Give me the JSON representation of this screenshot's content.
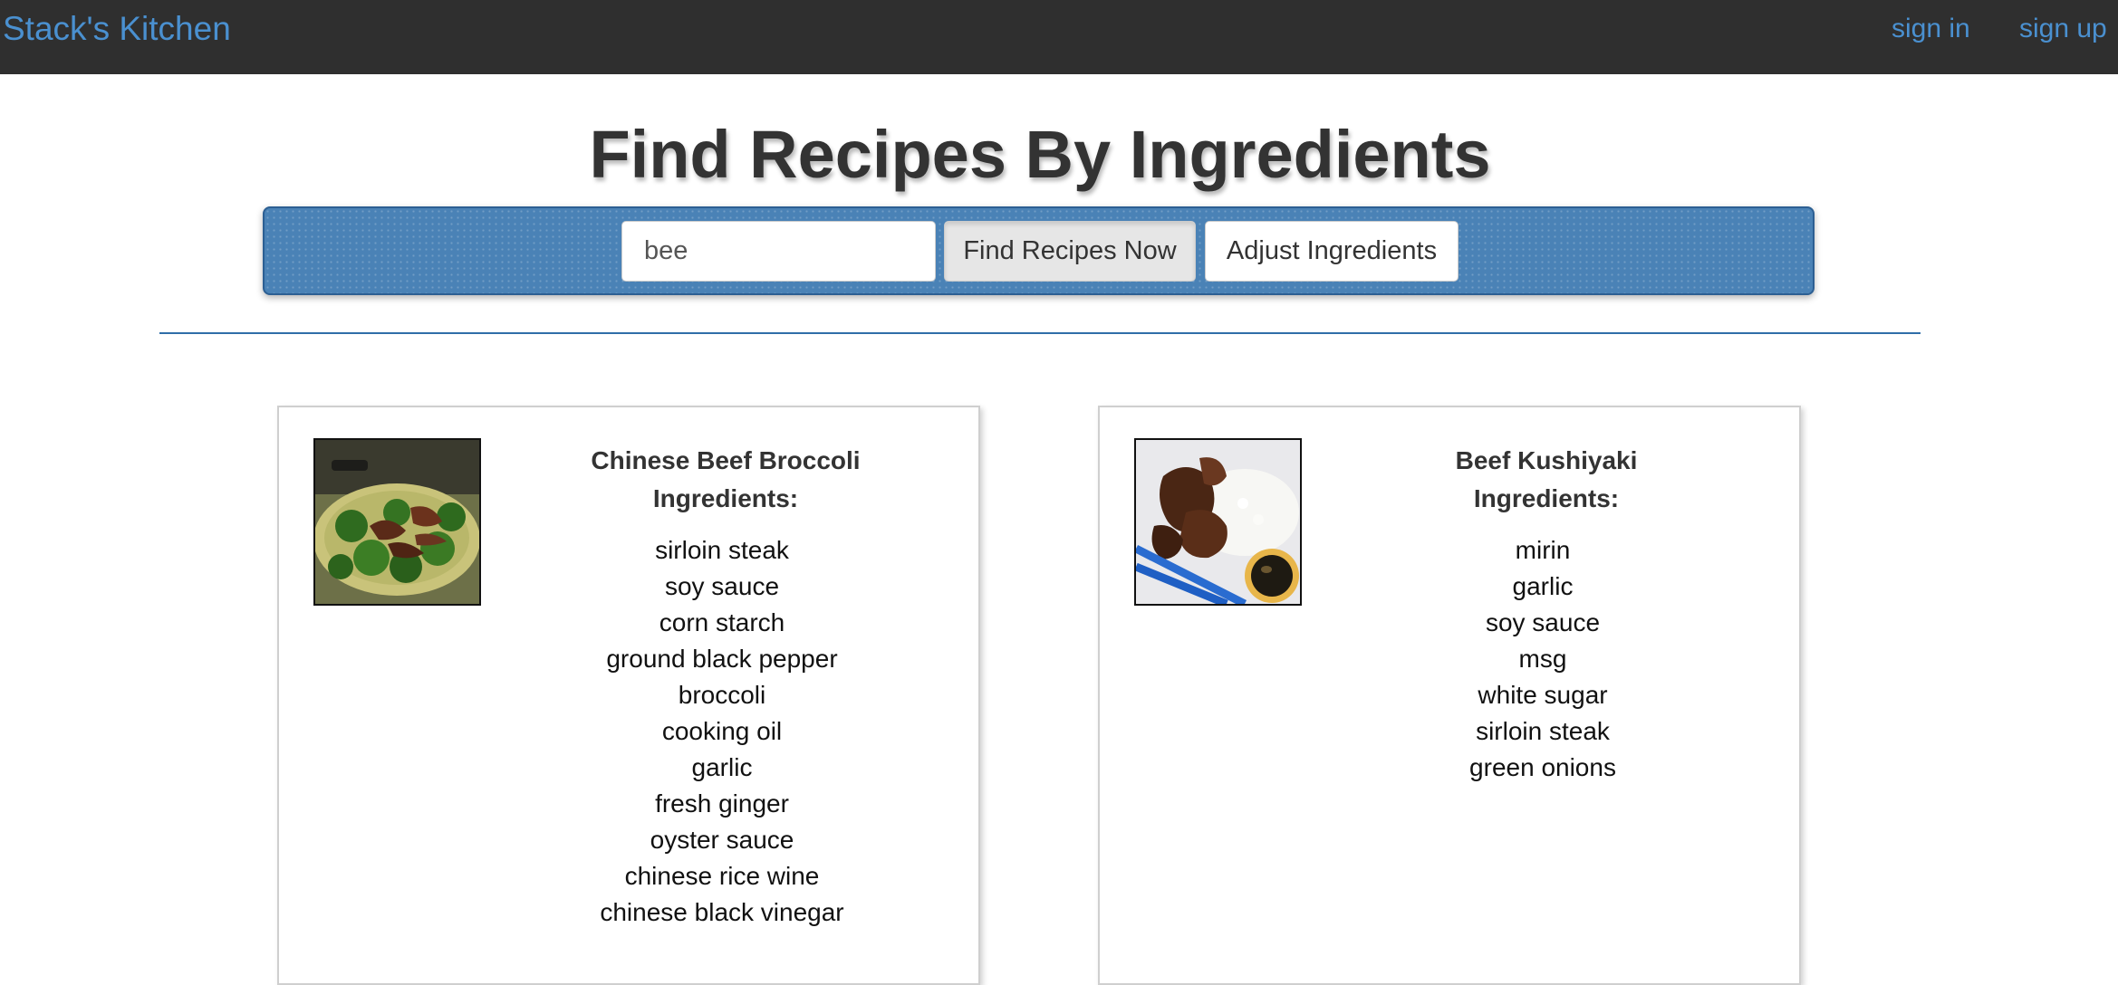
{
  "navbar": {
    "brand": "Stack's Kitchen",
    "links": [
      "sign in",
      "sign up"
    ]
  },
  "page": {
    "title": "Find Recipes By Ingredients"
  },
  "search": {
    "value": "bee",
    "find_label": "Find Recipes Now",
    "adjust_label": "Adjust Ingredients"
  },
  "recipes": [
    {
      "title": "Chinese Beef Broccoli",
      "ingredients_heading": "Ingredients:",
      "image_description": "beef-broccoli-photo",
      "ingredients": [
        "sirloin steak",
        "soy sauce",
        "corn starch",
        "ground black pepper",
        "broccoli",
        "cooking oil",
        "garlic",
        "fresh ginger",
        "oyster sauce",
        "chinese rice wine",
        "chinese black vinegar"
      ]
    },
    {
      "title": "Beef Kushiyaki",
      "ingredients_heading": "Ingredients:",
      "image_description": "beef-kushiyaki-photo",
      "ingredients": [
        "mirin",
        "garlic",
        "soy sauce",
        "msg",
        "white sugar",
        "sirloin steak",
        "green onions"
      ]
    }
  ],
  "colors": {
    "navbar_bg": "#2f2f2f",
    "link": "#4a90d0",
    "search_panel": "#4a82b6",
    "divider": "#2f6ea8"
  }
}
